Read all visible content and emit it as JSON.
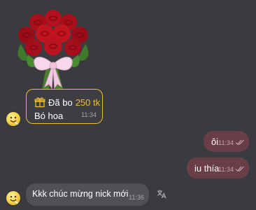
{
  "messages": {
    "sticker": {
      "icon": "rose-bouquet-sticker"
    },
    "gift": {
      "icon": "gift-icon",
      "action": "Đã bo",
      "amount": "250 tk",
      "text": "Bó hoa",
      "time": "11:34"
    },
    "outgoing": [
      {
        "text": "ôi",
        "time": "11:34",
        "status_icon": "double-check-icon"
      },
      {
        "text": "iu thía",
        "time": "11:34",
        "status_icon": "double-check-icon"
      }
    ],
    "incoming": {
      "text": "Kkk chúc mừng nick mới",
      "time": "11:36",
      "action_icon": "translate-icon"
    }
  },
  "colors": {
    "background": "#3a3b3f",
    "gift_border": "#f1bc33",
    "outgoing_bubble": "#693e46",
    "incoming_bubble": "#505155"
  }
}
